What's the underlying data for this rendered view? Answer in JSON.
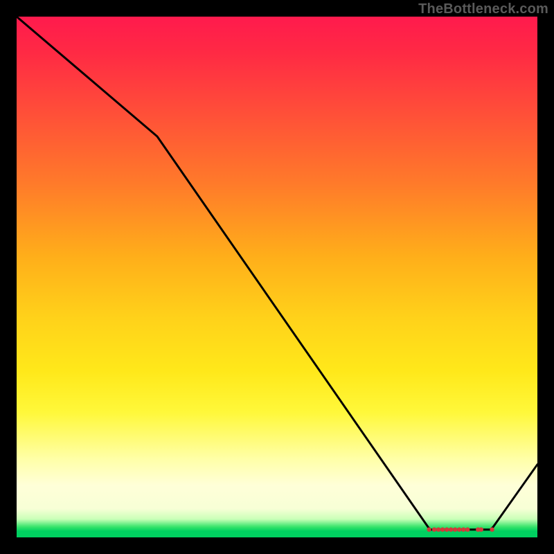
{
  "watermark": "TheBottleneck.com",
  "chart_data": {
    "type": "line",
    "title": "",
    "xlabel": "",
    "ylabel": "",
    "xlim": [
      0,
      100
    ],
    "ylim": [
      0,
      100
    ],
    "grid": false,
    "legend": false,
    "line": {
      "color": "#000000",
      "width": 2,
      "comment": "x as % across plot width, y as % of plot height (0=bottom). A descending trace that flattens to the baseline ~x=79..91 then rises at far right. First segment (x 0→27) has a slightly gentler slope than the long middle segment.",
      "points": [
        {
          "x": 0,
          "y": 100
        },
        {
          "x": 27,
          "y": 77
        },
        {
          "x": 79,
          "y": 2
        },
        {
          "x": 79.5,
          "y": 1.5
        },
        {
          "x": 91,
          "y": 1.5
        },
        {
          "x": 91.5,
          "y": 2
        },
        {
          "x": 100,
          "y": 14
        }
      ]
    },
    "markers": {
      "color": "#d23b3b",
      "radius_px": 3.2,
      "y": 1.5,
      "comment": "Row of small red dots sitting on the flat trough. Two slightly isolated dots near the right end before the upturn.",
      "x": [
        79.2,
        80.2,
        81.0,
        81.8,
        82.6,
        83.4,
        84.2,
        85.0,
        85.8,
        86.6,
        88.6,
        89.2,
        91.3
      ]
    }
  }
}
